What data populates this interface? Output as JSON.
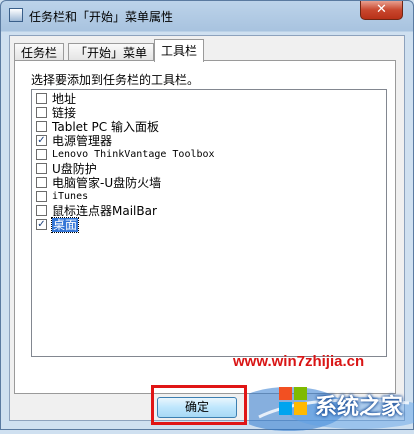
{
  "window": {
    "title": "任务栏和「开始」菜单属性",
    "close_glyph": "✕"
  },
  "tabs": [
    {
      "label": "任务栏"
    },
    {
      "label": "「开始」菜单"
    },
    {
      "label": "工具栏",
      "active": true
    }
  ],
  "toolbars": {
    "prompt": "选择要添加到任务栏的工具栏。",
    "items": [
      {
        "label": "地址",
        "checked": false
      },
      {
        "label": "链接",
        "checked": false
      },
      {
        "label": "Tablet PC 输入面板",
        "checked": false
      },
      {
        "label": "电源管理器",
        "checked": true
      },
      {
        "label": "Lenovo ThinkVantage Toolbox",
        "checked": false
      },
      {
        "label": "U盘防护",
        "checked": false
      },
      {
        "label": "电脑管家-U盘防火墙",
        "checked": false
      },
      {
        "label": "iTunes",
        "checked": false
      },
      {
        "label": "鼠标连点器MailBar",
        "checked": false
      },
      {
        "label": "桌面",
        "checked": true,
        "selected": true
      }
    ]
  },
  "buttons": {
    "ok_label": "确定"
  },
  "watermark": {
    "url": "www.win7zhijia.cn",
    "logo_text": "系统之家"
  },
  "colors": {
    "highlight": "#e01515",
    "watermark_url": "#d91515",
    "selection": "#3375d6"
  }
}
